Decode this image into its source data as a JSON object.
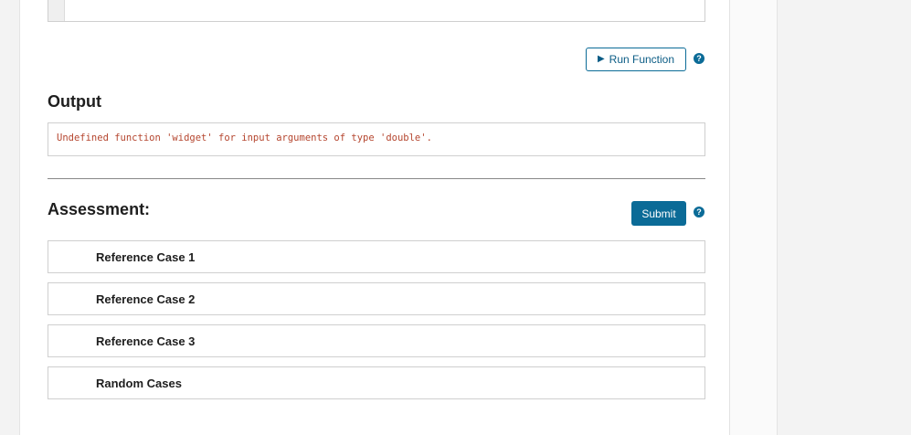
{
  "toolbar": {
    "run_label": "Run Function",
    "run_icon": "play-icon",
    "help_glyph": "?"
  },
  "output": {
    "heading": "Output",
    "message": "Undefined function 'widget' for input arguments of type 'double'."
  },
  "assessment": {
    "heading": "Assessment:",
    "submit_label": "Submit",
    "cases": [
      {
        "label": "Reference Case 1"
      },
      {
        "label": "Reference Case 2"
      },
      {
        "label": "Reference Case 3"
      },
      {
        "label": "Random Cases"
      }
    ]
  },
  "colors": {
    "accent": "#0b6b97",
    "error_text": "#b5462f"
  }
}
